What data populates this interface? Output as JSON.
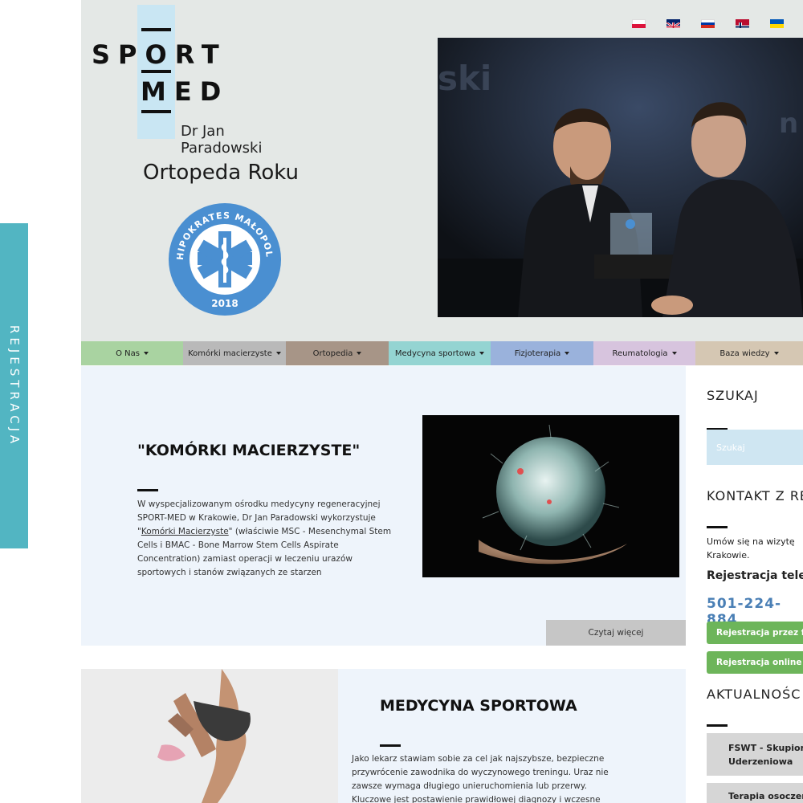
{
  "side_tab": {
    "label": "REJESTRACJA"
  },
  "logo": {
    "line1": "SPORT",
    "line2": "MED",
    "doctor": "Dr Jan Paradowski"
  },
  "award": {
    "title": "Ortopeda Roku",
    "seal_text": "HIPOKRATES MAŁOPOLSKI",
    "seal_year": "2018"
  },
  "languages": [
    "polish-flag-icon",
    "english-flag-icon",
    "russian-flag-icon",
    "norwegian-flag-icon",
    "ukrainian-flag-icon"
  ],
  "nav": [
    {
      "label": "O Nas",
      "color": "#a9d3a1"
    },
    {
      "label": "Komórki macierzyste",
      "color": "#b9b9b9"
    },
    {
      "label": "Ortopedia",
      "color": "#a79587"
    },
    {
      "label": "Medycyna sportowa",
      "color": "#94d4d2"
    },
    {
      "label": "Fizjoterapia",
      "color": "#9ab2dc"
    },
    {
      "label": "Reumatologia",
      "color": "#d7c4de"
    },
    {
      "label": "Baza wiedzy",
      "color": "#d5c7b3"
    }
  ],
  "card1": {
    "title": "\"KOMÓRKI MACIERZYSTE\"",
    "line1": "W wyspecjalizowanym ośrodku medycyny regeneracyjnej",
    "line2": "SPORT-MED w Krakowie, Dr Jan Paradowski wykorzystuje",
    "line3_pre": "\"",
    "line3_link": "Komórki Macierzyste",
    "line3_post": "\" (właściwie MSC - Mesenchymal Stem",
    "line4": "Cells i BMAC - Bone Marrow Stem Cells Aspirate",
    "line5": "Concentration) zamiast operacji w leczeniu urazów",
    "line6": "sportowych i stanów związanych ze starzen",
    "read_more": "Czytaj więcej"
  },
  "card2": {
    "title": "MEDYCYNA SPORTOWA",
    "line1": "Jako lekarz stawiam sobie za cel jak najszybsze, bezpieczne",
    "line2": "przywrócenie zawodnika do wyczynowego treningu. Uraz nie",
    "line3": "zawsze wymaga długiego unieruchomienia lub przerwy.",
    "line4": "Kluczowe jest postawienie prawidłowej diagnozy i wczesne"
  },
  "sidebar": {
    "search_heading": "SZUKAJ",
    "search_placeholder": "Szukaj",
    "contact_heading": "KONTAKT Z RE",
    "contact_line1": "Umów się na wizytę",
    "contact_line2": "Krakowie.",
    "phone_label": "Rejestracja tele",
    "phone": "501-224-884",
    "form_button": "Rejestracja przez form",
    "online_button": "Rejestracja online",
    "news_heading": "AKTUALNOŚC",
    "news": [
      {
        "line1": "FSWT - Skupion",
        "line2": "Uderzeniowa"
      },
      {
        "line1": "Terapia osoczem"
      }
    ]
  }
}
